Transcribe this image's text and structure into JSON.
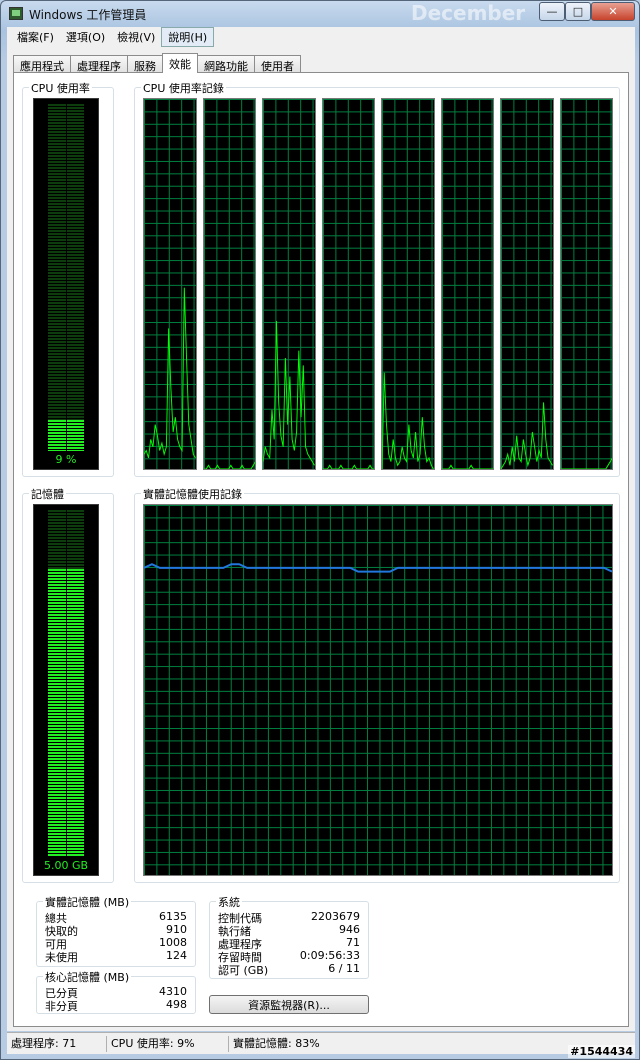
{
  "window": {
    "title": "Windows 工作管理員",
    "watermark": "December",
    "min_label": "—",
    "max_label": "□",
    "close_label": "✕"
  },
  "menu": [
    {
      "label": "檔案(F)"
    },
    {
      "label": "選項(O)"
    },
    {
      "label": "檢視(V)"
    },
    {
      "label": "說明(H)"
    }
  ],
  "tabs": [
    {
      "label": "應用程式"
    },
    {
      "label": "處理程序"
    },
    {
      "label": "服務"
    },
    {
      "label": "效能"
    },
    {
      "label": "網路功能"
    },
    {
      "label": "使用者"
    }
  ],
  "active_tab": 3,
  "cpu": {
    "label": "CPU 使用率",
    "value_text": "9 %",
    "percent": 9,
    "history_label": "CPU 使用率記錄",
    "core_series": [
      [
        4,
        5,
        3,
        8,
        6,
        12,
        9,
        5,
        7,
        4,
        6,
        38,
        22,
        10,
        14,
        8,
        6,
        5,
        49,
        30,
        12,
        8,
        4,
        3
      ],
      [
        0,
        0,
        1,
        0,
        0,
        0,
        1,
        0,
        0,
        0,
        0,
        0,
        1,
        0,
        0,
        0,
        0,
        1,
        0,
        0,
        0,
        0,
        1,
        2
      ],
      [
        2,
        6,
        4,
        3,
        16,
        8,
        40,
        18,
        9,
        6,
        30,
        12,
        25,
        8,
        5,
        10,
        32,
        14,
        28,
        6,
        4,
        3,
        2,
        1
      ],
      [
        0,
        0,
        0,
        1,
        0,
        0,
        0,
        0,
        1,
        0,
        0,
        0,
        0,
        0,
        1,
        0,
        0,
        0,
        0,
        0,
        0,
        1,
        0,
        0
      ],
      [
        0,
        26,
        12,
        4,
        2,
        8,
        3,
        1,
        2,
        6,
        3,
        2,
        12,
        5,
        3,
        10,
        2,
        4,
        14,
        6,
        2,
        3,
        1,
        0
      ],
      [
        0,
        0,
        0,
        0,
        1,
        0,
        0,
        0,
        0,
        0,
        0,
        0,
        0,
        1,
        0,
        0,
        0,
        0,
        0,
        0,
        0,
        0,
        0,
        0
      ],
      [
        0,
        1,
        2,
        4,
        1,
        6,
        2,
        9,
        3,
        2,
        8,
        4,
        1,
        3,
        10,
        6,
        2,
        5,
        3,
        18,
        8,
        3,
        2,
        1
      ],
      [
        0,
        0,
        0,
        0,
        0,
        0,
        0,
        0,
        0,
        0,
        0,
        0,
        0,
        0,
        0,
        0,
        0,
        0,
        0,
        0,
        0,
        1,
        2,
        3
      ]
    ]
  },
  "memory": {
    "label": "記憶體",
    "value_text": "5.00 GB",
    "percent": 83,
    "history_label": "實體記憶體使用記錄",
    "series": [
      83,
      84,
      83,
      83,
      83,
      83,
      83,
      83,
      83,
      83,
      83,
      84,
      84,
      83,
      83,
      83,
      83,
      83,
      83,
      83,
      83,
      83,
      83,
      83,
      83,
      83,
      83,
      82,
      82,
      82,
      82,
      82,
      83,
      83,
      83,
      83,
      83,
      83,
      83,
      83,
      83,
      83,
      83,
      83,
      83,
      83,
      83,
      83,
      83,
      83,
      83,
      83,
      83,
      83,
      83,
      83,
      83,
      83,
      83,
      82
    ]
  },
  "physical_memory": {
    "title": "實體記憶體 (MB)",
    "rows": [
      {
        "label": "總共",
        "value": "6135"
      },
      {
        "label": "快取的",
        "value": "910"
      },
      {
        "label": "可用",
        "value": "1008"
      },
      {
        "label": "未使用",
        "value": "124"
      }
    ]
  },
  "kernel_memory": {
    "title": "核心記憶體 (MB)",
    "rows": [
      {
        "label": "已分頁",
        "value": "4310"
      },
      {
        "label": "非分頁",
        "value": "498"
      }
    ]
  },
  "system": {
    "title": "系統",
    "rows": [
      {
        "label": "控制代碼",
        "value": "2203679"
      },
      {
        "label": "執行緒",
        "value": "946"
      },
      {
        "label": "處理程序",
        "value": "71"
      },
      {
        "label": "存留時間",
        "value": "0:09:56:33"
      },
      {
        "label": "認可 (GB)",
        "value": "6 / 11"
      }
    ]
  },
  "resmon_button": "資源監視器(R)...",
  "status": {
    "processes": "處理程序: 71",
    "cpu": "CPU 使用率: 9%",
    "memory": "實體記憶體: 83%"
  },
  "badge": "#1544434",
  "colors": {
    "graph_line": "#00ff00",
    "memory_line": "#2277dd",
    "grid": "#008040"
  }
}
